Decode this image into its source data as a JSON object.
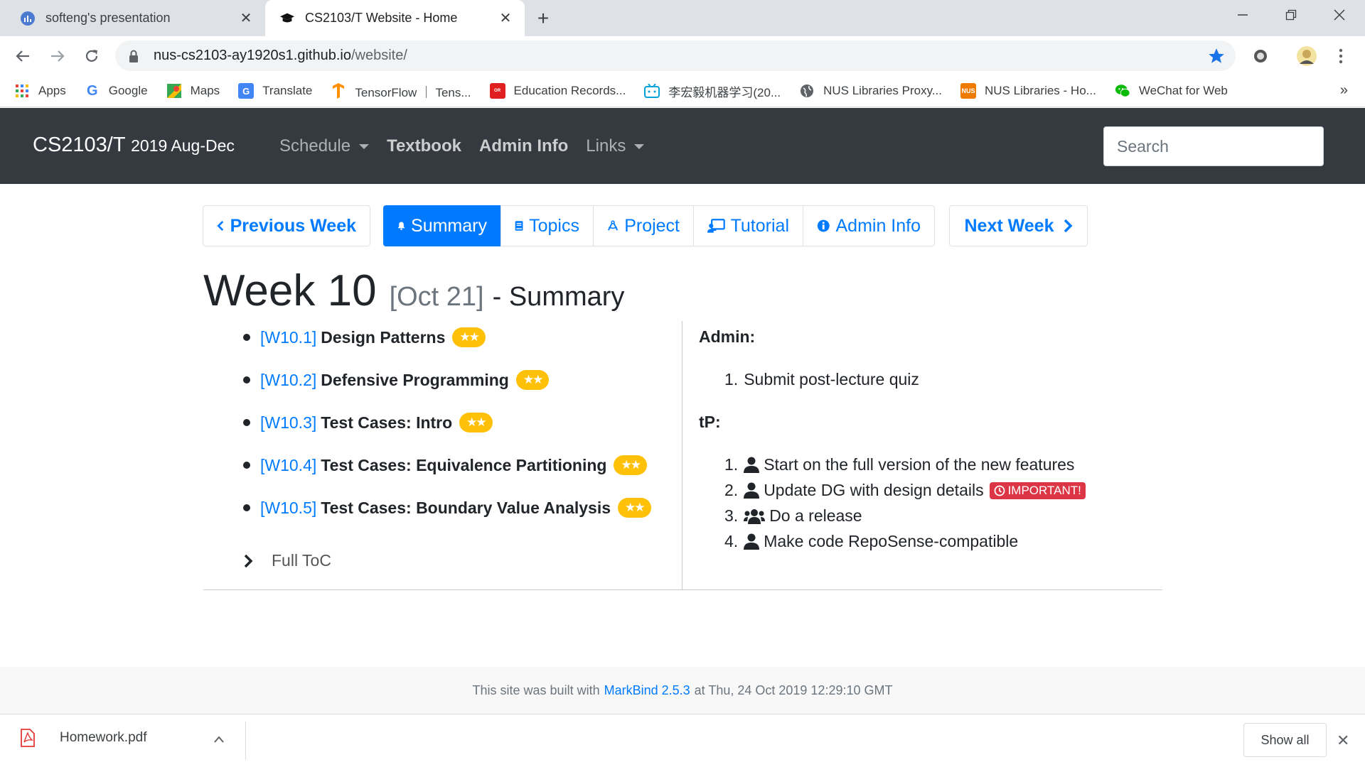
{
  "browser": {
    "tabs": [
      {
        "title": "softeng's presentation",
        "close": "✕"
      },
      {
        "title": "CS2103/T Website - Home",
        "close": "✕"
      }
    ],
    "new_tab": "+",
    "url_host": "nus-cs2103-ay1920s1.github.io",
    "url_path": "/website/",
    "bookmarks": [
      {
        "label": "Apps",
        "icon": "apps-grid-icon"
      },
      {
        "label": "Google",
        "icon": "google-icon"
      },
      {
        "label": "Maps",
        "icon": "maps-icon"
      },
      {
        "label": "Translate",
        "icon": "translate-icon"
      },
      {
        "label": "TensorFlow ｜ Tens...",
        "icon": "tensorflow-icon"
      },
      {
        "label": "Education Records...",
        "icon": "oracle-icon"
      },
      {
        "label": "李宏毅机器学习(20...",
        "icon": "bilibili-icon"
      },
      {
        "label": "NUS Libraries Proxy...",
        "icon": "globe-icon"
      },
      {
        "label": "NUS Libraries - Ho...",
        "icon": "nus-icon"
      },
      {
        "label": "WeChat for Web",
        "icon": "wechat-icon"
      }
    ],
    "bookmarks_more": "»"
  },
  "site": {
    "brand": "CS2103/T",
    "brand_sub": "2019 Aug-Dec",
    "nav": [
      {
        "label": "Schedule",
        "dropdown": true,
        "bold": false
      },
      {
        "label": "Textbook",
        "dropdown": false,
        "bold": true
      },
      {
        "label": "Admin Info",
        "dropdown": false,
        "bold": true
      },
      {
        "label": "Links",
        "dropdown": true,
        "bold": false
      }
    ],
    "search_placeholder": "Search"
  },
  "weeknav": {
    "previous": "Previous Week",
    "next": "Next Week",
    "tabs": [
      "Summary",
      "Topics",
      "Project",
      "Tutorial",
      "Admin Info"
    ]
  },
  "heading": {
    "week": "Week 10",
    "date": "[Oct 21]",
    "suffix": "- Summary"
  },
  "topics": [
    {
      "code": "[W10.1]",
      "name": "Design Patterns",
      "stars": "★★"
    },
    {
      "code": "[W10.2]",
      "name": "Defensive Programming",
      "stars": "★★"
    },
    {
      "code": "[W10.3]",
      "name": "Test Cases: Intro",
      "stars": "★★"
    },
    {
      "code": "[W10.4]",
      "name": "Test Cases: Equivalence Partitioning",
      "stars": "★★"
    },
    {
      "code": "[W10.5]",
      "name": "Test Cases: Boundary Value Analysis",
      "stars": "★★"
    }
  ],
  "toc_label": "Full ToC",
  "admin": {
    "heading": "Admin:",
    "items": [
      {
        "num": "1.",
        "text": "Submit post-lecture quiz"
      }
    ]
  },
  "tp": {
    "heading": "tP:",
    "items": [
      {
        "num": "1.",
        "text": "Start on the full version of the new features",
        "icon": "user-icon"
      },
      {
        "num": "2.",
        "text": "Update DG with design details",
        "icon": "user-icon",
        "badge": "IMPORTANT!"
      },
      {
        "num": "3.",
        "text": "Do a release",
        "icon": "users-icon"
      },
      {
        "num": "4.",
        "text": "Make code RepoSense-compatible",
        "icon": "user-icon"
      }
    ]
  },
  "footer": {
    "prefix": "This site was built with",
    "link": "MarkBind 2.5.3",
    "suffix": "at Thu, 24 Oct 2019 12:29:10 GMT"
  },
  "downloads": {
    "file": "Homework.pdf",
    "show_all": "Show all",
    "close": "✕"
  },
  "colors": {
    "primary": "#007bff",
    "navbar": "#343a40",
    "star_badge": "#ffc107",
    "important_badge": "#dc3545"
  }
}
